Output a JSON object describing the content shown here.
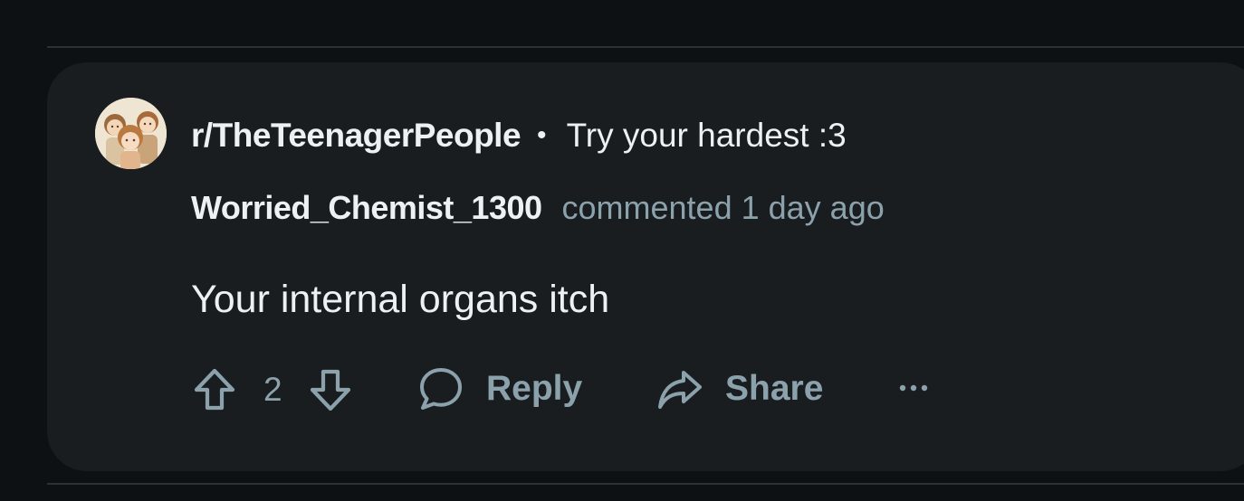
{
  "subreddit": {
    "name": "r/TheTeenagerPeople",
    "separator": "•",
    "post_title": "Try your hardest :3"
  },
  "comment": {
    "author": "Worried_Chemist_1300",
    "meta": "commented 1 day ago",
    "body": "Your internal organs itch",
    "score": "2"
  },
  "actions": {
    "reply_label": "Reply",
    "share_label": "Share"
  },
  "icons": {
    "upvote": "arrow-up-icon",
    "downvote": "arrow-down-icon",
    "reply": "speech-bubble-icon",
    "share": "share-arrow-icon",
    "more": "ellipsis-icon"
  },
  "colors": {
    "background": "#0e1113",
    "card": "#1a1d1f",
    "text_primary": "#eef1f3",
    "text_secondary": "#8ba2ad"
  }
}
